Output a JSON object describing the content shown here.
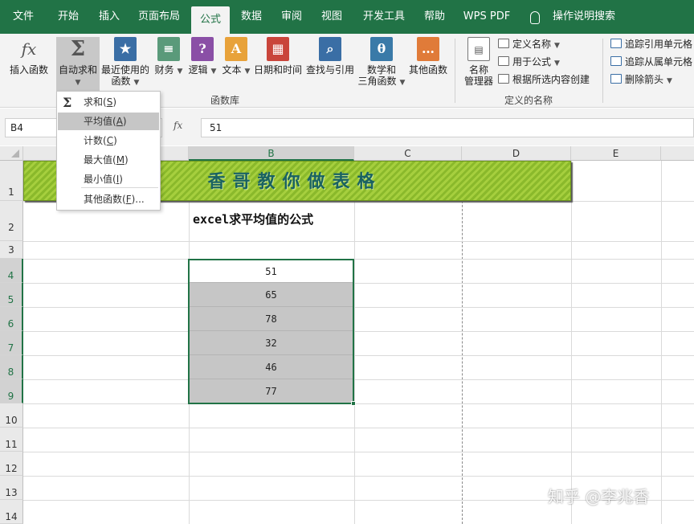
{
  "menu": {
    "tabs": [
      "文件",
      "开始",
      "插入",
      "页面布局",
      "公式",
      "数据",
      "审阅",
      "视图",
      "开发工具",
      "帮助",
      "WPS PDF"
    ],
    "active_tab": "公式",
    "search_hint": "操作说明搜索"
  },
  "ribbon": {
    "function_library": {
      "label": "函数库",
      "insert_function": "插入函数",
      "autosum": "自动求和",
      "recent_line1": "最近使用的",
      "recent_line2": "函数",
      "financial": "财务",
      "logical": "逻辑",
      "text": "文本",
      "datetime": "日期和时间",
      "lookup": "查找与引用",
      "math_line1": "数学和",
      "math_line2": "三角函数",
      "more": "其他函数"
    },
    "defined_names": {
      "label": "定义的名称",
      "name_manager_line1": "名称",
      "name_manager_line2": "管理器",
      "define_name": "定义名称",
      "use_in_formula": "用于公式",
      "create_from_selection": "根据所选内容创建"
    },
    "auditing": {
      "trace_precedents": "追踪引用单元格",
      "trace_dependents": "追踪从属单元格",
      "remove_arrows": "删除箭头"
    },
    "colors": {
      "brand": "#217346",
      "banner": "#8ab92b",
      "banner_text": "#1a6262"
    }
  },
  "formula_bar": {
    "name_box": "B4",
    "fx_label": "fx",
    "formula": "51"
  },
  "autosum_menu": {
    "items": [
      {
        "prefix": "求和(",
        "key": "S",
        "suffix": ")"
      },
      {
        "prefix": "平均值(",
        "key": "A",
        "suffix": ")"
      },
      {
        "prefix": "计数(",
        "key": "C",
        "suffix": ")"
      },
      {
        "prefix": "最大值(",
        "key": "M",
        "suffix": ")"
      },
      {
        "prefix": "最小值(",
        "key": "I",
        "suffix": ")"
      },
      {
        "prefix": "其他函数(",
        "key": "F",
        "suffix": ")..."
      }
    ],
    "highlighted_index": 1
  },
  "sheet": {
    "columns": [
      "B",
      "C",
      "D",
      "E"
    ],
    "selected_column": "B",
    "rows": [
      "1",
      "2",
      "3",
      "4",
      "5",
      "6",
      "7",
      "8",
      "9",
      "10",
      "11",
      "12",
      "13",
      "14"
    ],
    "banner": "香哥教你做表格",
    "title_cell": "excel求平均值的公式",
    "values": [
      "51",
      "65",
      "78",
      "32",
      "46",
      "77"
    ]
  },
  "watermark": "知乎 @李兆香"
}
